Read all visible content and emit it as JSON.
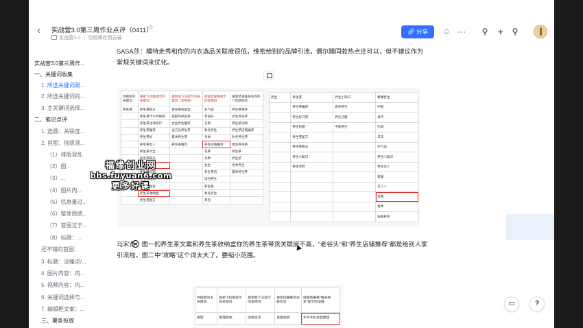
{
  "header": {
    "title": "实战营3.0第三周作业点评（0411）",
    "breadcrumb_space": "实战营3.0",
    "save_status": "已经保存到云端",
    "share_label": "分享",
    "icons": [
      "back-icon",
      "star-icon",
      "bell-icon",
      "more-icon",
      "search-icon",
      "plus-icon",
      "location-icon"
    ],
    "accent": "#3370ff"
  },
  "toc": {
    "items": [
      "实战营3.0第三周作...",
      "一、关键词收集",
      "1. 所选关键词跟...",
      "2. 所选关键词的...",
      "3. 主关键词选择...",
      "二、笔记点评",
      "1. 选题：关联度...",
      "2. 首图：排版混...",
      "（1）排版混乱",
      "（2）图...",
      "（3）...",
      "（4）图片内...",
      "（5）信息量过...",
      "（6）整体质感...",
      "（7）首图过于...",
      "（8）标题：...",
      "还不错的首图：",
      "3. 标题：没痛点/...",
      "4. 图片内容：内...",
      "5. 视频内容：内...",
      "6. 关键词选择与...",
      "7. 编辑框文案：...",
      "三、薯条投放"
    ]
  },
  "content": {
    "p1": "SASA莎：模特走秀和你的内衣选品关联度很低，维密给别的品牌引流，偶尔蹭同款热点还可以，但不建议作为常规关键词来优化。",
    "p2": "马宋贤：图一的养生茶文案和养生茶收纳盒你的养生茶带货关联度不高，“老谷头”和“养生店铺推荐”都是给别人家引流啦，图二中“攻略”这个词太大了，要缩小范围。"
  },
  "table1": {
    "headers": [
      "你搜索的关键词",
      "搜索下拉框提示的关键词",
      "搜索框下方提示的关键词（含相关）",
      "搜索结果框提示的关键词",
      "搜索结果框关注的热门话题标签"
    ],
    "rows": [
      [
        "养生茶",
        "养生茶配方",
        "养生茶收纳盒",
        "补气血",
        "养生茶推荐"
      ],
      [
        "",
        "养生茶什么时候喝",
        "搭配的养生茶",
        "老谷头",
        "女生养生茶"
      ],
      [
        "",
        "养生茶功效排行",
        "女生养生推荐",
        "花茶",
        "养生茶功效"
      ],
      [
        "",
        "养生茶推荐",
        "全方位养生茶",
        "秋冬养生",
        "养生茶店铺推荐"
      ],
      [
        "",
        "养生茶好",
        "夏季养生茶",
        "冬季",
        "秋冬养生茶"
      ],
      [
        "",
        "养生茶女人",
        "养生茶推荐",
        "养生店铺推荐",
        "便宜养生茶"
      ],
      [
        "",
        "养生茶大全",
        "",
        "花茶",
        "养生茶"
      ],
      [
        "",
        "养生茶喝法",
        "",
        "冬季",
        "养生茶"
      ],
      [
        "",
        "养生茶文案",
        "",
        "女生",
        "冬季养生"
      ],
      [
        "",
        "养生茶搭配",
        "",
        "养生茶包",
        "夏季养生茶"
      ],
      [
        "",
        "养生茶配比",
        "",
        "适合养生",
        ""
      ],
      [
        "",
        "养生茶组合",
        "",
        "养生茶",
        ""
      ],
      [
        "",
        "养生茶收纳盒",
        "",
        "秋冬养生",
        ""
      ],
      [
        "",
        "养生茶配方",
        "",
        "茶包",
        ""
      ]
    ]
  },
  "table2": {
    "rows": [
      [
        "养生",
        "养生茶",
        "养生小知识",
        "健康养生"
      ],
      [
        "",
        "养生茶推荐",
        "春季养生",
        "中医"
      ],
      [
        "",
        "养生好习惯",
        "养生汉服",
        "食疗"
      ],
      [
        "",
        "养生药膳",
        "中医养生",
        "内调"
      ],
      [
        "",
        "养生茶配方",
        "",
        "日常"
      ],
      [
        "",
        "养生茶做法",
        "",
        "补气血"
      ],
      [
        "",
        "养生小知识",
        "",
        "养生小知识"
      ],
      [
        "",
        "养生项目",
        "",
        "养生达人"
      ],
      [
        "",
        "",
        "",
        "健康"
      ],
      [
        "",
        "",
        "",
        "打工人"
      ],
      [
        "",
        "",
        "",
        "攻略"
      ],
      [
        "",
        "",
        "",
        "春季"
      ],
      [
        "",
        "",
        "",
        "居家养生"
      ]
    ]
  },
  "table3": {
    "headers": [
      "你搜索的主关键词",
      "搜索下拉框提示的关键词",
      "搜索框下方提示的关键词",
      "搜索结果框的关联标签",
      "搜索结果框\"相关搜索\"提示的词语"
    ],
    "row": [
      "整理",
      "整理收纳",
      "收纳生活",
      "桌面收纳",
      "华为手机桌面整理"
    ]
  },
  "watermark": {
    "line1": "福缘创业网",
    "line2": "bbs.fuyuan6.com",
    "line3": "更多好课"
  },
  "fabs": [
    "doc-outline-icon",
    "help-icon"
  ]
}
